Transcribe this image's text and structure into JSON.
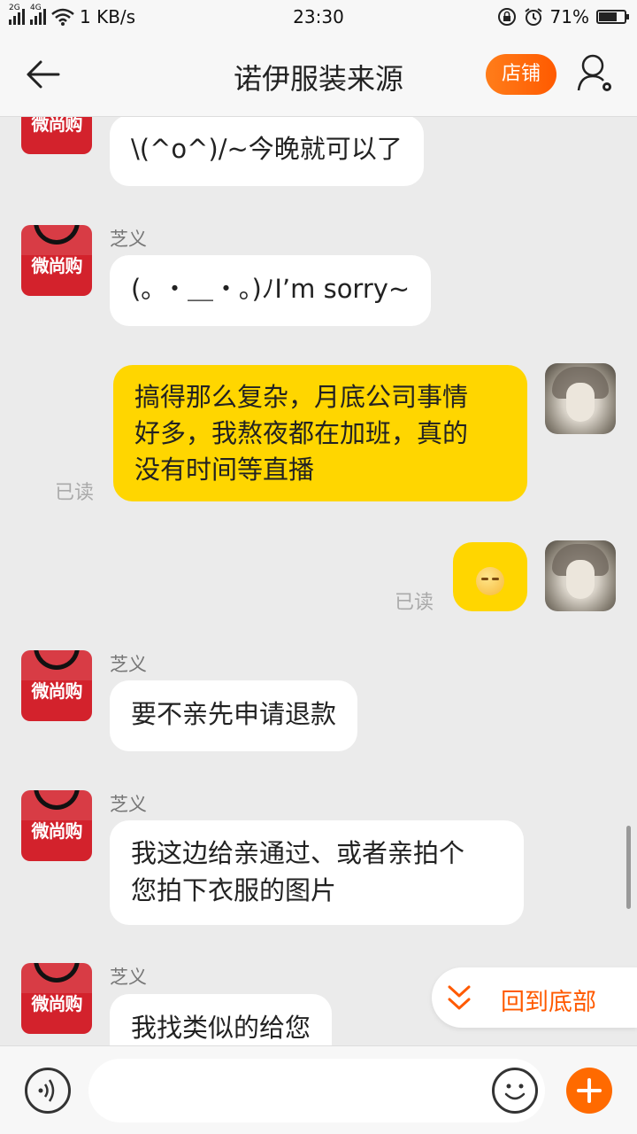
{
  "status_bar": {
    "network_speed": "1 KB/s",
    "time": "23:30",
    "battery": "71%",
    "battery_level": 0.71,
    "signal_labels": [
      "2G",
      "4G"
    ]
  },
  "header": {
    "title": "诺伊服装来源",
    "shop_button": "店铺",
    "back_icon": "back-arrow-icon",
    "profile_icon": "user-settings-icon"
  },
  "shop_avatar_logo": "微尚购",
  "messages": [
    {
      "side": "left",
      "sender": "",
      "text": "\\(^o^)/~今晚就可以了"
    },
    {
      "side": "left",
      "sender": "芝义",
      "text": "(｡ ・＿・｡)ﾉI’m sorry~"
    },
    {
      "side": "right",
      "lines": [
        "搞得那么复杂，月底公司事情",
        "好多，我熬夜都在加班，真的",
        "没有时间等直播"
      ],
      "status": "已读"
    },
    {
      "side": "right",
      "emoji": "pensive-face-icon",
      "status": "已读"
    },
    {
      "side": "left",
      "sender": "芝义",
      "text": "要不亲先申请退款"
    },
    {
      "side": "left",
      "sender": "芝义",
      "lines": [
        "我这边给亲通过、或者亲拍个",
        "您拍下衣服的图片"
      ]
    },
    {
      "side": "left",
      "sender": "芝义",
      "text": "我找类似的给您"
    }
  ],
  "back_to_bottom": "回到底部",
  "input_bar": {
    "placeholder": "",
    "voice_icon": "voice-icon",
    "emoji_icon": "smiley-icon",
    "plus_icon": "plus-icon"
  },
  "colors": {
    "accent": "#ff6a00",
    "my_bubble": "#ffd600",
    "shop_red": "#d3222c"
  }
}
